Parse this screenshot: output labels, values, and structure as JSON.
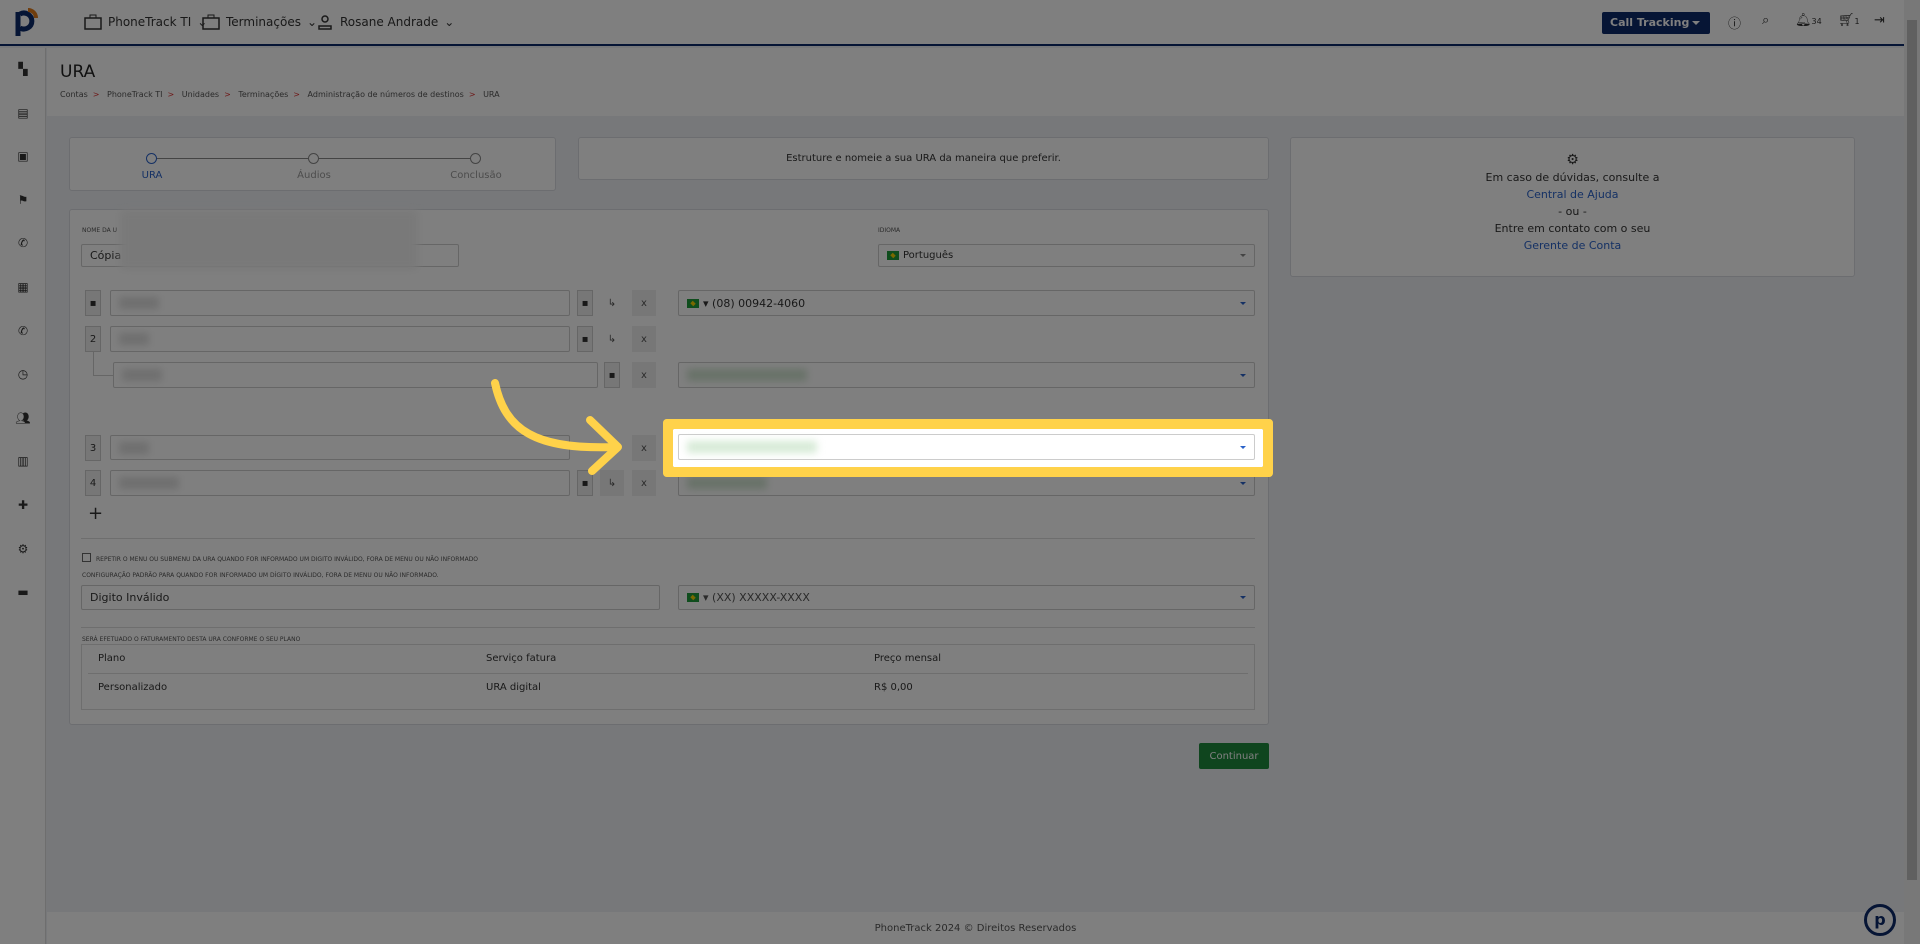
{
  "header": {
    "nav": [
      {
        "label": "PhoneTrack TI",
        "icon": "briefcase-icon"
      },
      {
        "label": "Terminações",
        "icon": "briefcase-icon"
      },
      {
        "label": "Rosane Andrade",
        "icon": "user-icon"
      }
    ],
    "product_select": "Call Tracking",
    "notifications": "34",
    "cart": "1"
  },
  "page": {
    "title": "URA",
    "breadcrumb": [
      "Contas",
      "PhoneTrack TI",
      "Unidades",
      "Terminações",
      "Administração de números de destinos",
      "URA"
    ]
  },
  "stepper": {
    "steps": [
      "URA",
      "Áudios",
      "Conclusão"
    ],
    "active": 0
  },
  "info": "Estruture e nomeie a sua URA da maneira que preferir.",
  "help": {
    "line1": "Em caso de dúvidas, consulte a",
    "link1": "Central de Ajuda",
    "or": "- ou -",
    "line2": "Entre em contato com o seu",
    "link2": "Gerente de Conta"
  },
  "form": {
    "name_label": "NOME DA U",
    "name_value": "Cópia",
    "language_label": "IDIOMA",
    "language_value": "Português",
    "rows": [
      {
        "key": "",
        "phone": "(08) 00942-4060"
      },
      {
        "key": "2",
        "phone": ""
      },
      {
        "key": "",
        "phone": ""
      },
      {
        "key": "3",
        "phone": ""
      },
      {
        "key": "4",
        "phone": ""
      }
    ],
    "add": "+",
    "remove": "x",
    "redirect": "↳",
    "repeat_label": "REPETIR O MENU OU SUBMENU DA URA QUANDO FOR INFORMADO UM DIGITO INVÁLIDO, FORA DE MENU OU NÃO INFORMADO",
    "default_label": "CONFIGURAÇÃO PADRÃO PARA QUANDO FOR INFORMADO UM DÍGITO INVÁLIDO, FORA DE MENU OU NÃO INFORMADO.",
    "invalid_value": "Digito Inválido",
    "phone_placeholder": "(XX) XXXXX-XXXX",
    "billing_label": "SERÁ EFETUADO O FATURAMENTO DESTA URA CONFORME O SEU PLANO",
    "billing": {
      "headers": [
        "Plano",
        "Serviço fatura",
        "Preço mensal"
      ],
      "row": [
        "Personalizado",
        "URA digital",
        "R$ 0,00"
      ]
    }
  },
  "continue": "Continuar",
  "footer": "PhoneTrack 2024 © Direitos Reservados"
}
